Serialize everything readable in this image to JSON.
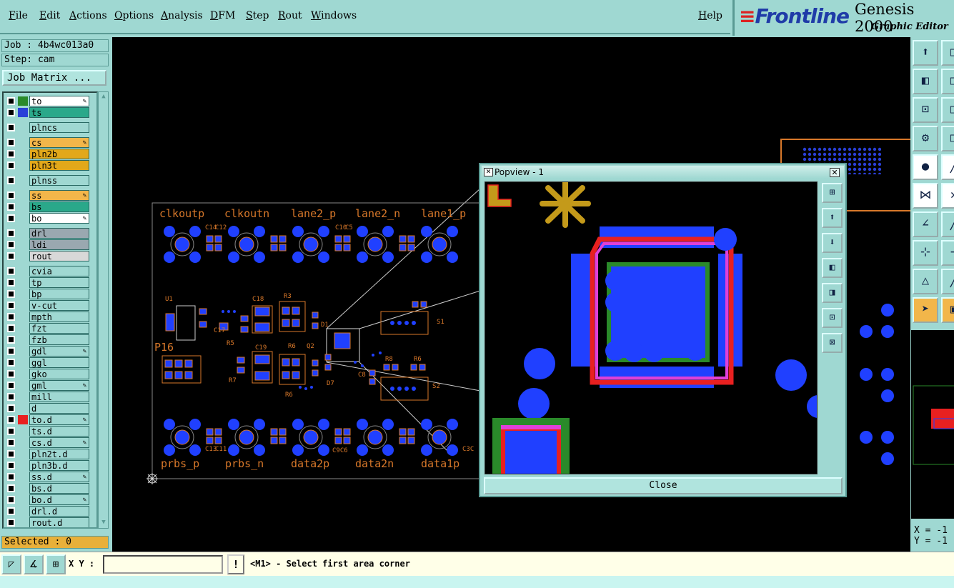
{
  "menu": {
    "items": [
      "File",
      "Edit",
      "Actions",
      "Options",
      "Analysis",
      "DFM",
      "Step",
      "Rout",
      "Windows"
    ],
    "help": "Help"
  },
  "brand": {
    "logo": "Frontline",
    "product": "Genesis 2000",
    "subtitle": "Graphic Editor"
  },
  "job": {
    "job_line": "Job : 4b4wc013a0",
    "step_line": "Step: cam",
    "matrix_button": "Job Matrix ..."
  },
  "layers": [
    {
      "name": "to",
      "swatch": "#2a8a2a",
      "bg": "#ffffff",
      "edit": true
    },
    {
      "name": "ts",
      "swatch": "#2a40d8",
      "bg": "#2aa88a",
      "edit": false
    },
    {
      "name": "plncs",
      "swatch": "#9fd8d2",
      "bg": "#9fd8d2",
      "edit": false
    },
    {
      "name": "cs",
      "swatch": "#9fd8d2",
      "bg": "#f2b64a",
      "edit": true
    },
    {
      "name": "pln2b",
      "swatch": "#9fd8d2",
      "bg": "#e2a81a",
      "edit": false
    },
    {
      "name": "pln3t",
      "swatch": "#9fd8d2",
      "bg": "#e2a81a",
      "edit": false
    },
    {
      "name": "plnss",
      "swatch": "#9fd8d2",
      "bg": "#9fd8d2",
      "edit": false
    },
    {
      "name": "ss",
      "swatch": "#9fd8d2",
      "bg": "#f2b64a",
      "edit": true
    },
    {
      "name": "bs",
      "swatch": "#9fd8d2",
      "bg": "#2aa88a",
      "edit": false
    },
    {
      "name": "bo",
      "swatch": "#9fd8d2",
      "bg": "#ffffff",
      "edit": true
    },
    {
      "name": "drl",
      "swatch": "#9fd8d2",
      "bg": "#9aa8b0",
      "edit": false
    },
    {
      "name": "ldi",
      "swatch": "#9fd8d2",
      "bg": "#9aa8b0",
      "edit": false
    },
    {
      "name": "rout",
      "swatch": "#9fd8d2",
      "bg": "#d8d8d8",
      "edit": false
    },
    {
      "name": "cvia",
      "swatch": "#9fd8d2",
      "bg": "#9fd8d2",
      "edit": false
    },
    {
      "name": "tp",
      "swatch": "#9fd8d2",
      "bg": "#9fd8d2",
      "edit": false
    },
    {
      "name": "bp",
      "swatch": "#9fd8d2",
      "bg": "#9fd8d2",
      "edit": false
    },
    {
      "name": "v-cut",
      "swatch": "#9fd8d2",
      "bg": "#9fd8d2",
      "edit": false
    },
    {
      "name": "mpth",
      "swatch": "#9fd8d2",
      "bg": "#9fd8d2",
      "edit": false
    },
    {
      "name": "fzt",
      "swatch": "#9fd8d2",
      "bg": "#9fd8d2",
      "edit": false
    },
    {
      "name": "fzb",
      "swatch": "#9fd8d2",
      "bg": "#9fd8d2",
      "edit": false
    },
    {
      "name": "gdl",
      "swatch": "#9fd8d2",
      "bg": "#9fd8d2",
      "edit": true
    },
    {
      "name": "ggl",
      "swatch": "#9fd8d2",
      "bg": "#9fd8d2",
      "edit": false
    },
    {
      "name": "gko",
      "swatch": "#9fd8d2",
      "bg": "#9fd8d2",
      "edit": false
    },
    {
      "name": "gml",
      "swatch": "#9fd8d2",
      "bg": "#9fd8d2",
      "edit": true
    },
    {
      "name": "mill",
      "swatch": "#9fd8d2",
      "bg": "#9fd8d2",
      "edit": false
    },
    {
      "name": "d",
      "swatch": "#9fd8d2",
      "bg": "#9fd8d2",
      "edit": false
    },
    {
      "name": "to.d",
      "swatch": "#e82020",
      "bg": "#9fd8d2",
      "edit": true
    },
    {
      "name": "ts.d",
      "swatch": "#9fd8d2",
      "bg": "#9fd8d2",
      "edit": false
    },
    {
      "name": "cs.d",
      "swatch": "#9fd8d2",
      "bg": "#9fd8d2",
      "edit": true
    },
    {
      "name": "pln2t.d",
      "swatch": "#9fd8d2",
      "bg": "#9fd8d2",
      "edit": false
    },
    {
      "name": "pln3b.d",
      "swatch": "#9fd8d2",
      "bg": "#9fd8d2",
      "edit": false
    },
    {
      "name": "ss.d",
      "swatch": "#9fd8d2",
      "bg": "#9fd8d2",
      "edit": true
    },
    {
      "name": "bs.d",
      "swatch": "#9fd8d2",
      "bg": "#9fd8d2",
      "edit": false
    },
    {
      "name": "bo.d",
      "swatch": "#9fd8d2",
      "bg": "#9fd8d2",
      "edit": true
    },
    {
      "name": "drl.d",
      "swatch": "#9fd8d2",
      "bg": "#9fd8d2",
      "edit": false
    },
    {
      "name": "rout.d",
      "swatch": "#9fd8d2",
      "bg": "#9fd8d2",
      "edit": false
    }
  ],
  "selected": "Selected : 0",
  "board": {
    "top_labels": [
      "clkoutp",
      "clkoutn",
      "lane2_p",
      "lane2_n",
      "lane1_p"
    ],
    "bottom_labels": [
      "prbs_p",
      "prbs_n",
      "data2p",
      "data2n",
      "data1p"
    ],
    "left_label": "P16",
    "refs": [
      "U1",
      "C18",
      "R3",
      "S1",
      "C17",
      "R5",
      "C19",
      "R6",
      "R7",
      "R8",
      "R6",
      "S2",
      "C8",
      "Q2",
      "C14",
      "C12",
      "C10",
      "C5",
      "C13",
      "C11",
      "C9C6",
      "C3C",
      "R6",
      "D1",
      "D7"
    ]
  },
  "popview": {
    "title": "Popview - 1",
    "close": "Close"
  },
  "coords": {
    "x": "X = -1",
    "y": "Y = -1"
  },
  "bottom": {
    "xy_label": "X Y :",
    "xy_value": "",
    "bang": "!",
    "prompt": "<M1> - Select first area corner"
  }
}
